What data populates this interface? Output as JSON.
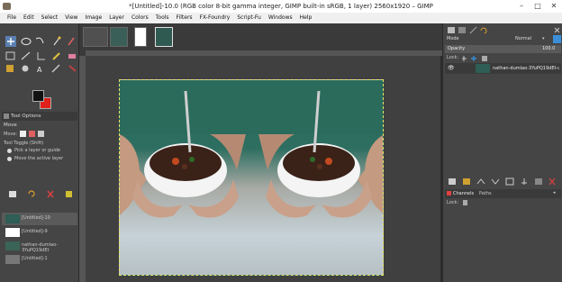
{
  "window": {
    "title": "*[Untitled]-10.0 (RGB color 8-bit gamma integer, GIMP built-in sRGB, 1 layer) 2560x1920 – GIMP",
    "min_label": "–",
    "max_label": "□",
    "close_label": "✕"
  },
  "menu": [
    "File",
    "Edit",
    "Select",
    "View",
    "Image",
    "Layer",
    "Colors",
    "Tools",
    "Filters",
    "FX-Foundry",
    "Script-Fu",
    "Windows",
    "Help"
  ],
  "tool_options": {
    "title": "Tool Options",
    "tool_name": "Move",
    "move_label": "Move:",
    "toggle_label": "Tool Toggle  (Shift)",
    "options": [
      "Pick a layer or guide",
      "Move the active layer"
    ]
  },
  "images_list": [
    {
      "label": "[Untitled]-10"
    },
    {
      "label": "[Untitled]-9"
    },
    {
      "label": "nathan-dumlao-3YuPQ19dEt"
    },
    {
      "label": "[Untitled]-1"
    }
  ],
  "layers": {
    "mode_label": "Mode",
    "mode_value": "Normal",
    "opacity_label": "Opacity",
    "opacity_value": "100.0",
    "lock_label": "Lock:",
    "layer_name": "nathan-dumlao-3YuPQ19dEt-uns"
  },
  "channels": {
    "tab_channels": "Channels",
    "tab_paths": "Paths",
    "lock_label": "Lock:"
  },
  "colors": {
    "fg": "#111111",
    "bg": "#e0201a",
    "accent": "#3a8fd8"
  }
}
